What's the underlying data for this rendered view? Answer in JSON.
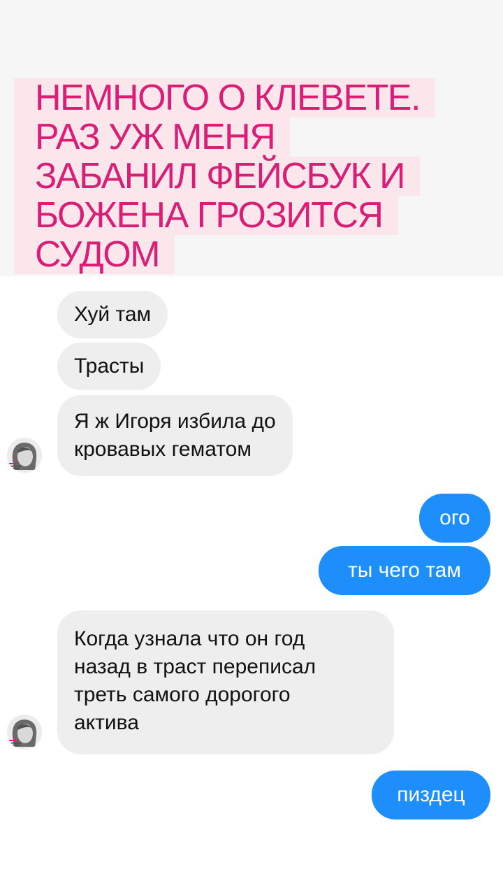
{
  "headline": {
    "lines": [
      "НЕМНОГО О КЛЕВЕТЕ.",
      "РАЗ УЖ МЕНЯ",
      "ЗАБАНИЛ ФЕЙСБУК И",
      "БОЖЕНА ГРОЗИТСЯ",
      "СУДОМ"
    ]
  },
  "messages": [
    {
      "side": "incoming",
      "lines": [
        "Хуй там"
      ]
    },
    {
      "side": "incoming",
      "lines": [
        "Трасты"
      ]
    },
    {
      "side": "incoming",
      "lines": [
        "Я ж Игоря избила до",
        "кровавых гематом"
      ]
    },
    {
      "side": "outgoing",
      "lines": [
        "ого"
      ]
    },
    {
      "side": "outgoing",
      "lines": [
        "ты чего там"
      ]
    },
    {
      "side": "incoming",
      "lines": [
        "Когда узнала что он год",
        "назад в траст переписал",
        "треть самого дорогого",
        "актива"
      ]
    },
    {
      "side": "outgoing",
      "lines": [
        "пиздец"
      ]
    }
  ],
  "colors": {
    "headline_text": "#d81e75",
    "headline_highlight": "#fbe6ec",
    "incoming_bubble": "#eeeeef",
    "outgoing_bubble": "#1e8ffa"
  },
  "icons": {
    "avatar": "sender-avatar-icon"
  }
}
